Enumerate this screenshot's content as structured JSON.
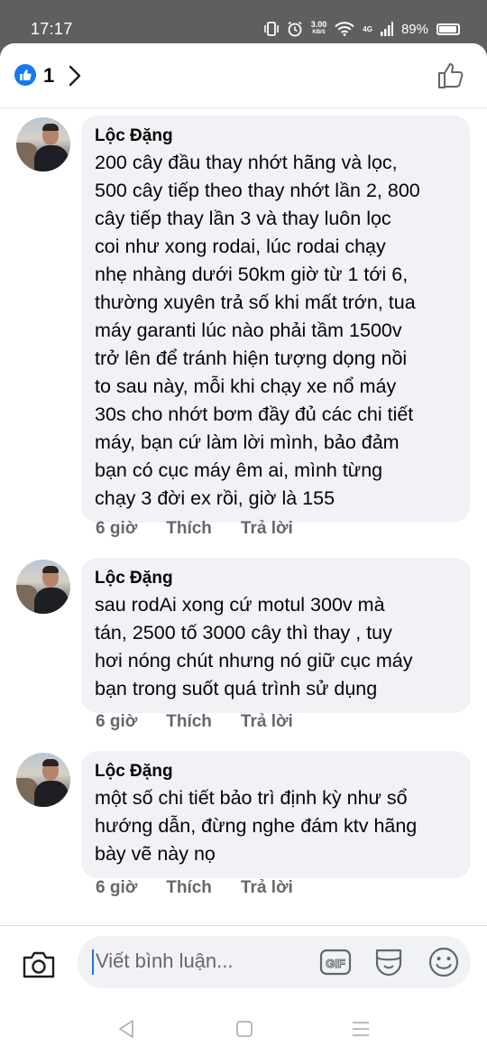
{
  "status_bar": {
    "time": "17:17",
    "net_speed_value": "3.00",
    "net_speed_unit": "KB/S",
    "signal": "4G",
    "battery": "89%"
  },
  "header": {
    "like_count": "1",
    "icons": [
      "like-reaction-icon",
      "chevron-right-icon",
      "thumbs-up-icon"
    ],
    "accent_color": "#1877f2"
  },
  "comments": [
    {
      "author": "Lộc Đặng",
      "text": "200 cây đầu thay nhớt hãng và lọc,\n500 cây tiếp theo thay nhớt lần 2, 800\ncây tiếp thay lần 3 và thay luôn lọc\ncoi như xong rodai, lúc rodai chạy\nnhẹ nhàng dưới 50km giờ từ 1 tới 6,\nthường xuyên trả số khi mất trớn, tua\nmáy garanti lúc nào phải tầm 1500v\ntrở lên để tránh hiện tượng dọng nồi\nto sau này, mỗi khi chạy xe nổ máy\n30s cho nhớt bơm đầy đủ các chi tiết\nmáy, bạn cứ làm lời mình, bảo đảm\nbạn có cục máy êm ai, mình từng\nchạy 3 đời ex rồi, giờ là 155",
      "time": "6 giờ",
      "like_label": "Thích",
      "reply_label": "Trả lời"
    },
    {
      "author": "Lộc Đặng",
      "text": "sau rodAi xong cứ motul 300v mà\ntán, 2500 tố 3000 cây thì thay , tuy\nhơi nóng chút nhưng nó giữ cục máy\nbạn trong suốt quá trình sử dụng",
      "time": "6 giờ",
      "like_label": "Thích",
      "reply_label": "Trả lời"
    },
    {
      "author": "Lộc Đặng",
      "text": "một số chi tiết bảo trì định kỳ như sổ\nhướng dẫn, đừng nghe đám ktv hãng\nbày vẽ này nọ",
      "time": "6 giờ",
      "like_label": "Thích",
      "reply_label": "Trả lời"
    }
  ],
  "composer": {
    "placeholder": "Viết bình luận...",
    "gif_label": "GIF",
    "icons": [
      "camera-icon",
      "gif-icon",
      "sticker-icon",
      "emoji-icon"
    ]
  },
  "nav": {
    "icons": [
      "back-icon",
      "home-icon",
      "menu-icon"
    ]
  }
}
